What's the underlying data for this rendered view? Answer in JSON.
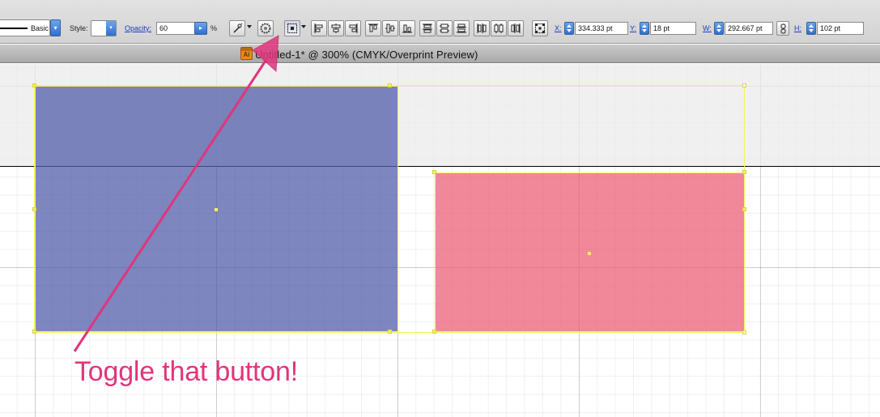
{
  "control_bar": {
    "stroke_style_label": "Basic",
    "style_label": "Style:",
    "opacity_label": "Opacity:",
    "opacity_value": "60",
    "opacity_unit": "%",
    "transform": {
      "x_label": "X:",
      "x_value": "334.333 pt",
      "y_label": "Y:",
      "y_value": "18 pt",
      "w_label": "W:",
      "w_value": "292.667 pt",
      "h_label": "H:",
      "h_value": "102 pt"
    }
  },
  "document": {
    "title": "Untitled-1* @ 300% (CMYK/Overprint Preview)",
    "app_icon_label": "Ai"
  },
  "canvas": {
    "blue_rect_color": "#525eaa",
    "pink_rect_color": "#eb5a73",
    "selection_color": "#f6f25a"
  },
  "annotation": {
    "text": "Toggle that button!",
    "color": "#e0357c"
  }
}
